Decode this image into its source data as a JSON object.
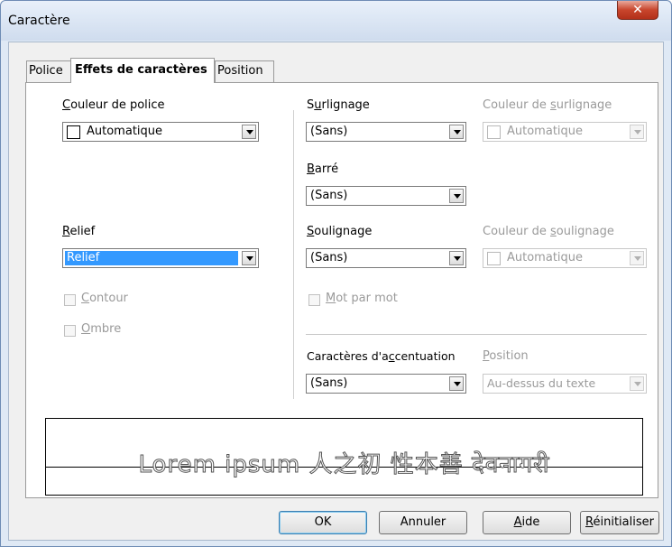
{
  "window": {
    "title": "Caractère",
    "close_glyph": "✕"
  },
  "tabs": [
    {
      "label": "Police"
    },
    {
      "label": "Effets de caractères"
    },
    {
      "label": "Position"
    }
  ],
  "font_color": {
    "label_u": "C",
    "label_rest": "ouleur de police",
    "value": "Automatique"
  },
  "relief": {
    "label_u": "R",
    "label_rest": "elief",
    "value": "Relief"
  },
  "contour": {
    "label_u": "C",
    "label_rest": "ontour"
  },
  "ombre": {
    "label_u": "O",
    "label_rest": "mbre"
  },
  "highlight": {
    "label_pre": "S",
    "label_u": "u",
    "label_rest": "rlignage",
    "value": "(Sans)"
  },
  "highlight_color": {
    "label_pre": "Couleur de ",
    "label_u": "s",
    "label_rest": "urlignage",
    "value": "Automatique"
  },
  "strikethrough": {
    "label_u": "B",
    "label_rest": "arré",
    "value": "(Sans)"
  },
  "underline": {
    "label_u": "S",
    "label_rest": "oulignage",
    "value": "(Sans)"
  },
  "underline_color": {
    "label_pre": "Couleur de ",
    "label_u": "s",
    "label_rest": "oulignage",
    "value": "Automatique"
  },
  "word_by_word": {
    "label_u": "M",
    "label_rest": "ot par mot"
  },
  "emphasis": {
    "label_pre": "Caractères d'a",
    "label_u": "c",
    "label_rest": "centuation",
    "value": "(Sans)"
  },
  "position": {
    "label_u": "P",
    "label_rest": "osition",
    "value": "Au-dessus du texte"
  },
  "preview": {
    "text": "Lorem ipsum   人之初 性本善   देवनागरी"
  },
  "buttons": {
    "ok": "OK",
    "cancel": "Annuler",
    "help_u": "A",
    "help_rest": "ide",
    "reset_u": "R",
    "reset_rest": "éinitialiser"
  }
}
